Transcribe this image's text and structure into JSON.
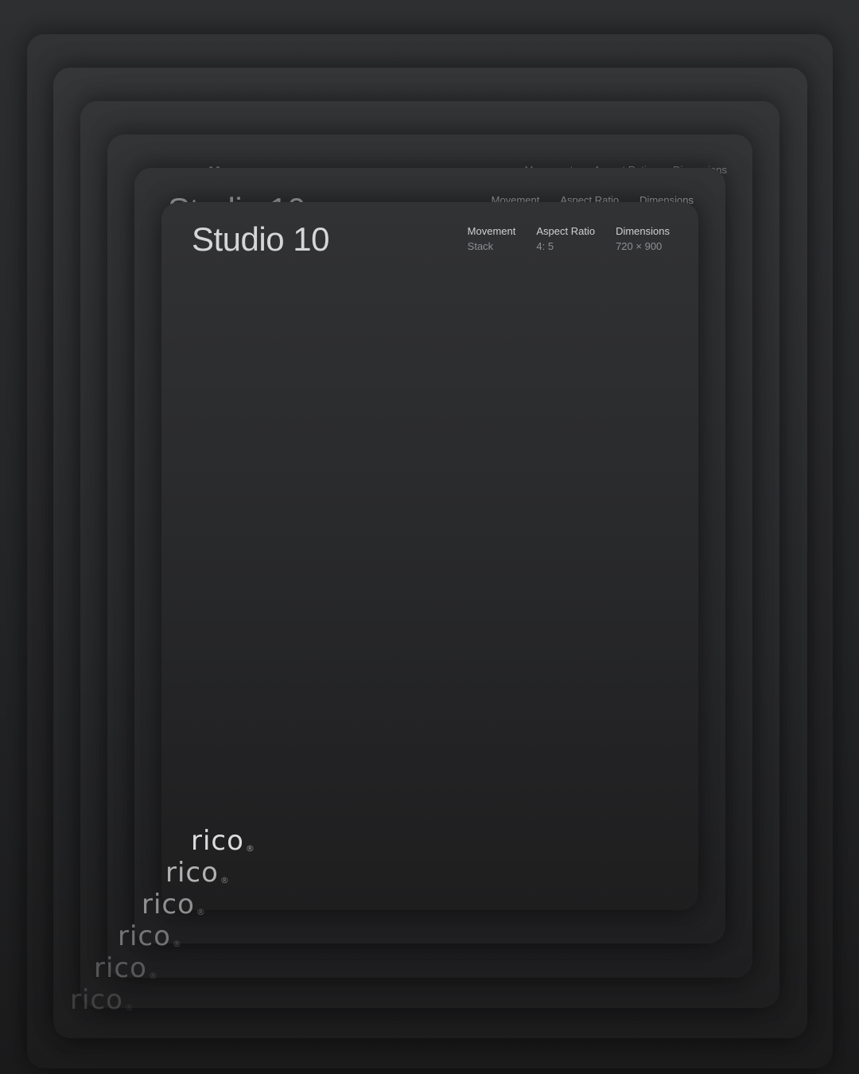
{
  "card": {
    "title": "Studio 10",
    "meta": [
      {
        "label": "Movement",
        "value": "Stack"
      },
      {
        "label": "Aspect Ratio",
        "value": "4: 5"
      },
      {
        "label": "Dimensions",
        "value": "720 × 900"
      }
    ]
  },
  "logo": {
    "text": "rico",
    "mark": "®"
  },
  "colors": {
    "background_top": "#2e2f31",
    "background_bottom": "#1b1b1c",
    "title_text": "#d6d6d8",
    "meta_value": "#8e8f93"
  }
}
